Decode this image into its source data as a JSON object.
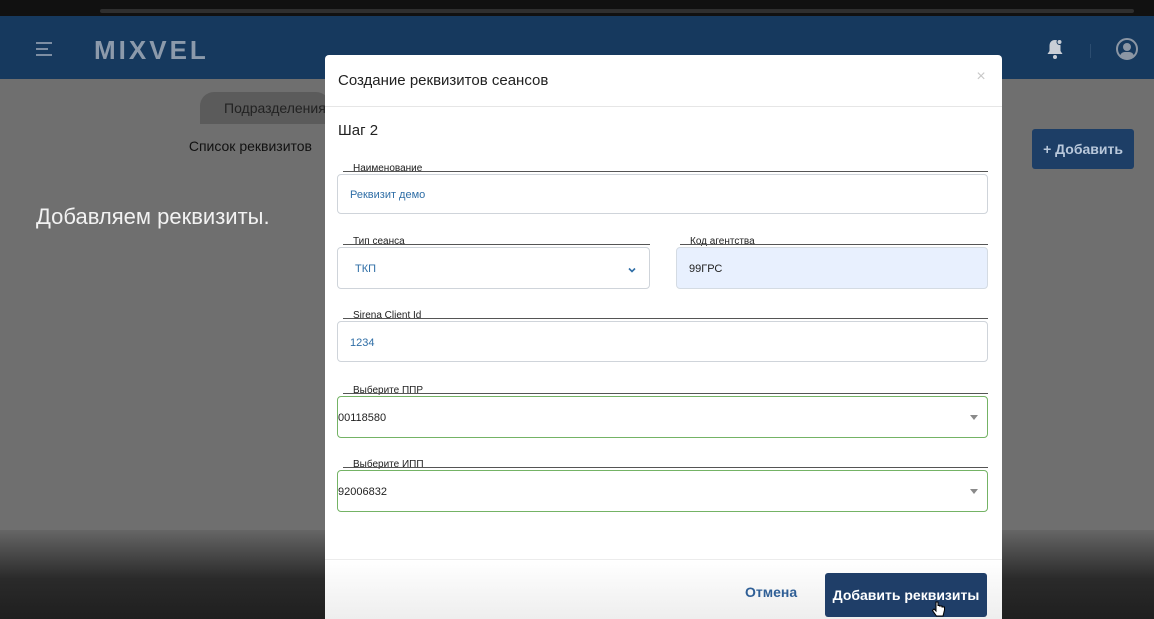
{
  "app": {
    "brand": "MIXVEL",
    "menu_icon": "hamburger-icon",
    "notification_icon": "bell-icon",
    "profile_icon": "user-circle-icon"
  },
  "background": {
    "tab_label": "Подразделения",
    "list_label": "Список реквизитов",
    "add_button": "+ Добавить",
    "caption": "Добавляем реквизиты."
  },
  "modal": {
    "title": "Создание реквизитов сеансов",
    "close_icon": "close-icon",
    "step": "Шаг 2",
    "fields": {
      "name": {
        "label": "Наименование",
        "value": "Реквизит демо"
      },
      "session_type": {
        "label": "Тип сеанса",
        "value": "ТКП"
      },
      "agency_code": {
        "label": "Код агентства",
        "value": "99ГРС"
      },
      "sirena_client_id": {
        "label": "Sirena Client Id",
        "value": "1234"
      },
      "ppr": {
        "label": "Выберите ППР",
        "value": "00118580"
      },
      "ipp": {
        "label": "Выберите ИПП",
        "value": "92006832"
      }
    },
    "cancel_label": "Отмена",
    "submit_label": "Добавить реквизиты"
  },
  "colors": {
    "navbar": "#16395e",
    "primary_button": "#1f3e68",
    "valid_border": "#74b365",
    "autofill_bg": "#e8f0fe"
  }
}
